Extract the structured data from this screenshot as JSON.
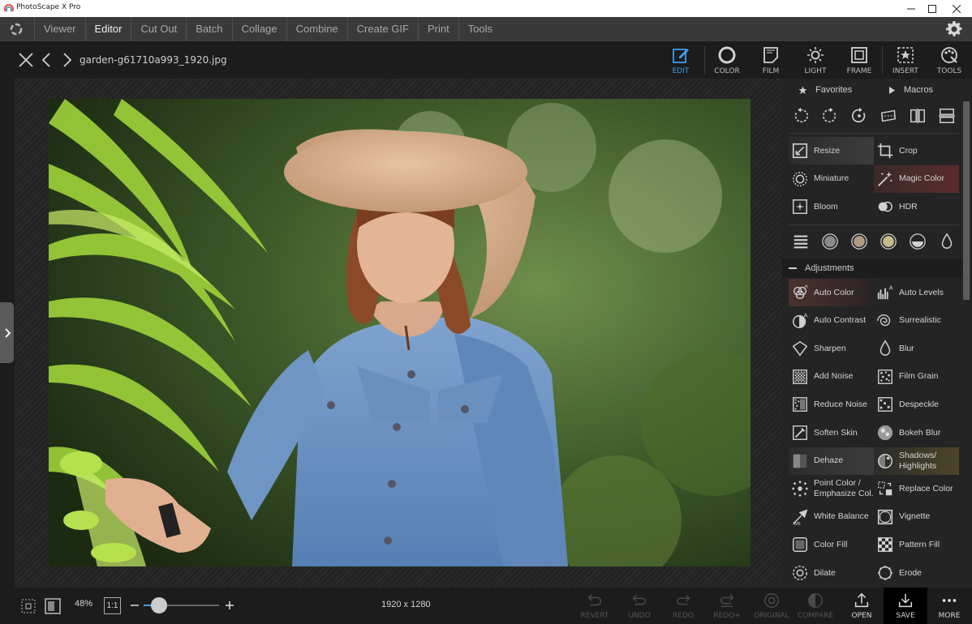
{
  "window": {
    "title": "PhotoScape X Pro"
  },
  "menu": {
    "tabs": [
      "Viewer",
      "Editor",
      "Cut Out",
      "Batch",
      "Collage",
      "Combine",
      "Create GIF",
      "Print",
      "Tools"
    ],
    "active": "Editor"
  },
  "toolbar": {
    "filename": "garden-g61710a993_1920.jpg",
    "tools": [
      {
        "label": "EDIT",
        "icon": "edit-icon",
        "active": true
      },
      {
        "label": "COLOR",
        "icon": "color-icon"
      },
      {
        "label": "FILM",
        "icon": "film-icon"
      },
      {
        "label": "LIGHT",
        "icon": "light-icon"
      },
      {
        "label": "FRAME",
        "icon": "frame-icon"
      },
      {
        "label": "INSERT",
        "icon": "insert-icon"
      },
      {
        "label": "TOOLS",
        "icon": "tools-icon"
      }
    ]
  },
  "panel": {
    "tabs": {
      "favorites": "Favorites",
      "macros": "Macros"
    },
    "rotate_icons": [
      "rotate-left-icon",
      "rotate-right-icon",
      "rotate-free-icon",
      "straighten-icon",
      "flip-horizontal-icon",
      "flip-vertical-icon"
    ],
    "top_items": [
      {
        "label": "Resize",
        "icon": "resize-icon"
      },
      {
        "label": "Crop",
        "icon": "crop-icon"
      },
      {
        "label": "Miniature",
        "icon": "miniature-icon"
      },
      {
        "label": "Magic Color",
        "icon": "magic-color-icon"
      },
      {
        "label": "Bloom",
        "icon": "bloom-icon"
      },
      {
        "label": "HDR",
        "icon": "hdr-icon"
      }
    ],
    "tone_icons": [
      "tone-menu-icon",
      "tone-gray-icon",
      "tone-sepia-icon",
      "tone-yellow-icon",
      "tone-half-icon",
      "tone-drop-icon"
    ],
    "adjustments_header": "Adjustments",
    "adjustments": [
      {
        "label": "Auto Color",
        "icon": "auto-color-icon"
      },
      {
        "label": "Auto Levels",
        "icon": "auto-levels-icon"
      },
      {
        "label": "Auto Contrast",
        "icon": "auto-contrast-icon"
      },
      {
        "label": "Surrealistic",
        "icon": "surrealistic-icon"
      },
      {
        "label": "Sharpen",
        "icon": "sharpen-icon"
      },
      {
        "label": "Blur",
        "icon": "blur-icon"
      },
      {
        "label": "Add Noise",
        "icon": "add-noise-icon"
      },
      {
        "label": "Film Grain",
        "icon": "film-grain-icon"
      },
      {
        "label": "Reduce Noise",
        "icon": "reduce-noise-icon"
      },
      {
        "label": "Despeckle",
        "icon": "despeckle-icon"
      },
      {
        "label": "Soften Skin",
        "icon": "soften-skin-icon"
      },
      {
        "label": "Bokeh Blur",
        "icon": "bokeh-blur-icon"
      },
      {
        "label": "Dehaze",
        "icon": "dehaze-icon"
      },
      {
        "label": "Shadows/\nHighlights",
        "icon": "shadows-highlights-icon"
      },
      {
        "label": "Point Color /\nEmphasize Col.",
        "icon": "point-color-icon"
      },
      {
        "label": "Replace Color",
        "icon": "replace-color-icon"
      },
      {
        "label": "White Balance",
        "icon": "white-balance-icon"
      },
      {
        "label": "Vignette",
        "icon": "vignette-icon"
      },
      {
        "label": "Color Fill",
        "icon": "color-fill-icon"
      },
      {
        "label": "Pattern Fill",
        "icon": "pattern-fill-icon"
      },
      {
        "label": "Dilate",
        "icon": "dilate-icon"
      },
      {
        "label": "Erode",
        "icon": "erode-icon"
      }
    ]
  },
  "bottom": {
    "zoom": "48%",
    "actual_size": "1:1",
    "zoom_level": 0.2,
    "dimensions": "1920 x 1280",
    "actions": [
      {
        "label": "REVERT",
        "enabled": false
      },
      {
        "label": "UNDO",
        "enabled": false
      },
      {
        "label": "REDO",
        "enabled": false
      },
      {
        "label": "REDO+",
        "enabled": false
      },
      {
        "label": "ORIGINAL",
        "enabled": false
      },
      {
        "label": "COMPARE",
        "enabled": false
      },
      {
        "label": "OPEN",
        "enabled": true
      },
      {
        "label": "SAVE",
        "enabled": true
      },
      {
        "label": "MORE",
        "enabled": true
      }
    ]
  },
  "colors": {
    "accent": "#3d9cf0",
    "background": "#1f1f1f",
    "panel": "#242424"
  }
}
